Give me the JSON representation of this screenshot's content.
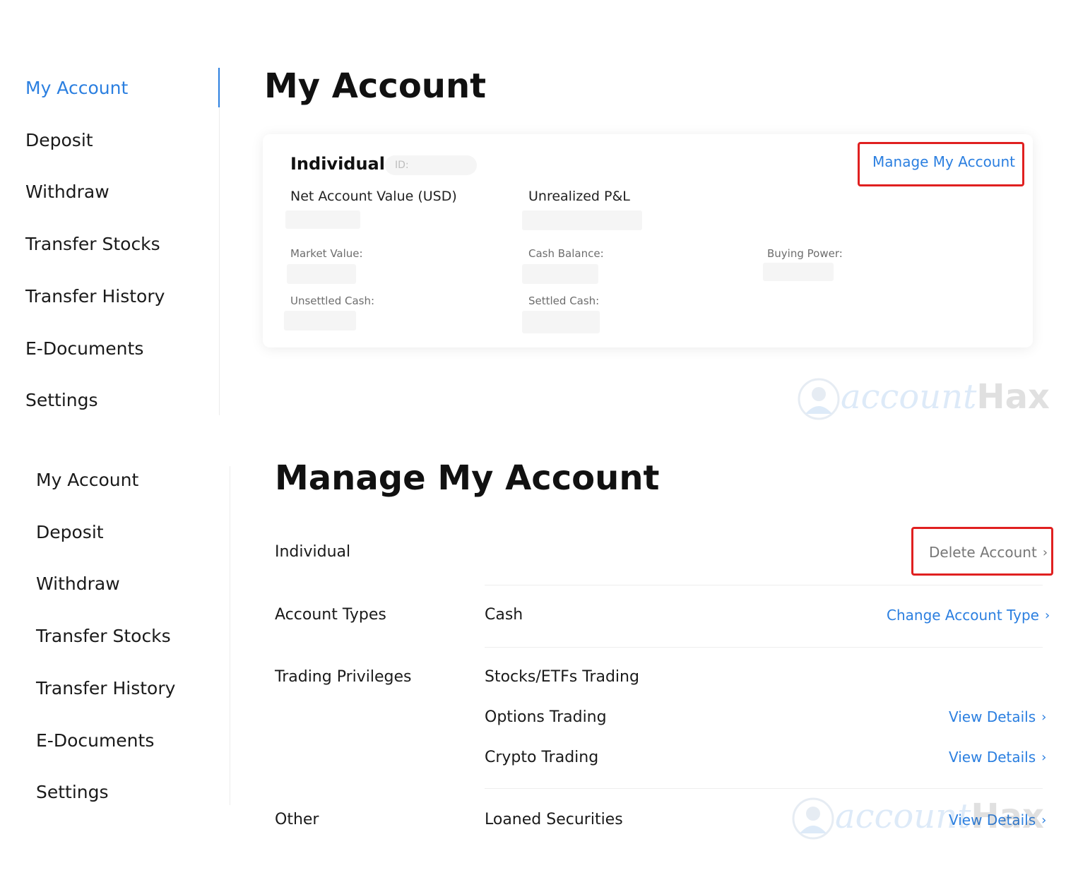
{
  "top": {
    "sidebar": {
      "items": [
        {
          "label": "My Account",
          "active": true
        },
        {
          "label": "Deposit"
        },
        {
          "label": "Withdraw"
        },
        {
          "label": "Transfer Stocks"
        },
        {
          "label": "Transfer History"
        },
        {
          "label": "E-Documents"
        },
        {
          "label": "Settings"
        }
      ]
    },
    "title": "My Account",
    "card": {
      "account_type": "Individual",
      "id_label": "ID:",
      "manage_link": "Manage My Account",
      "net_account_value_label": "Net Account Value (USD)",
      "unrealized_pl_label": "Unrealized P&L",
      "market_value_label": "Market Value:",
      "cash_balance_label": "Cash Balance:",
      "buying_power_label": "Buying Power:",
      "unsettled_cash_label": "Unsettled Cash:",
      "settled_cash_label": "Settled Cash:"
    }
  },
  "bottom": {
    "sidebar": {
      "items": [
        {
          "label": "My Account"
        },
        {
          "label": "Deposit"
        },
        {
          "label": "Withdraw"
        },
        {
          "label": "Transfer Stocks"
        },
        {
          "label": "Transfer History"
        },
        {
          "label": "E-Documents"
        },
        {
          "label": "Settings"
        }
      ]
    },
    "title": "Manage My Account",
    "account_type": "Individual",
    "delete_account": "Delete Account",
    "account_types_label": "Account Types",
    "account_type_value": "Cash",
    "change_account_type": "Change Account Type",
    "trading_privileges_label": "Trading Privileges",
    "stocks_etfs": "Stocks/ETFs Trading",
    "options": "Options Trading",
    "crypto": "Crypto Trading",
    "view_details": "View Details",
    "other_label": "Other",
    "loaned_securities": "Loaned Securities"
  },
  "watermark": {
    "brand_script": "account",
    "brand_bold": "Hax"
  },
  "colors": {
    "accent": "#2b7fe0",
    "highlight": "#e02020",
    "text": "#1a1a1a",
    "muted": "#6d6d6d"
  }
}
